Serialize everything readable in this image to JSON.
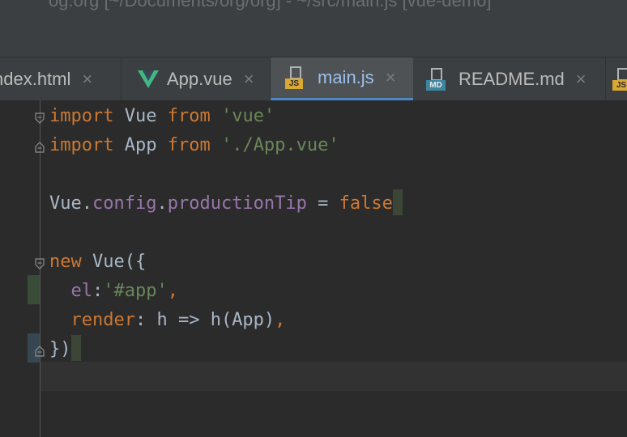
{
  "title_bar": {
    "text": "og.org [~/Documents/org/org] - ~/src/main.js [vue-demo]"
  },
  "tabs": [
    {
      "label": "ndex.html",
      "icon": "html-file-icon",
      "active": false
    },
    {
      "label": "App.vue",
      "icon": "vue-logo-icon",
      "active": false
    },
    {
      "label": "main.js",
      "icon": "js-file-icon",
      "active": true,
      "badge": "JS"
    },
    {
      "label": "README.md",
      "icon": "markdown-file-icon",
      "active": false,
      "badge": "MD"
    }
  ],
  "close_glyph": "×",
  "colors": {
    "keyword": "#cc7832",
    "string": "#6a8759",
    "property": "#9876aa",
    "text": "#a9b7c6",
    "background": "#2b2b2b",
    "active_tab_underline": "#4a88c7"
  },
  "code": {
    "l1": {
      "kw": "import",
      "a": " Vue ",
      "kw2": "from",
      "b": " ",
      "str": "'vue'"
    },
    "l2": {
      "kw": "import",
      "a": " App ",
      "kw2": "from",
      "b": " ",
      "str": "'./App.vue'"
    },
    "l4": {
      "a": "Vue.",
      "p1": "config",
      "b": ".",
      "p2": "productionTip",
      "c": " = ",
      "kw": "false"
    },
    "l6": {
      "kw": "new",
      "a": " Vue({"
    },
    "l7": {
      "indent": "  ",
      "p": "el",
      "a": ":",
      "str": "'#app'",
      "b": ","
    },
    "l8": {
      "indent": "  ",
      "kw": "render",
      "a": ": h => h(App)",
      "b": ","
    },
    "l9": {
      "a": "})"
    }
  }
}
